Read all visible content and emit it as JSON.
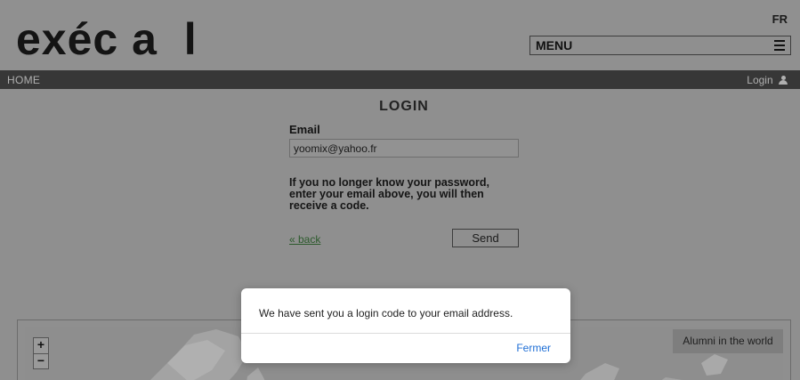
{
  "header": {
    "logo": "exéc a  l",
    "language": "FR",
    "menu_label": "MENU"
  },
  "nav": {
    "home": "HOME",
    "login": "Login"
  },
  "login_form": {
    "title": "LOGIN",
    "email_label": "Email",
    "email_value": "yoomix@yahoo.fr",
    "info_text": "If you no longer know your password, enter your email above, you will then receive a code.",
    "back_link": "« back",
    "send_button": "Send"
  },
  "map": {
    "zoom_in": "+",
    "zoom_out": "−",
    "label": "Alumni in the world"
  },
  "dialog": {
    "message": "We have sent you a login code to your email address.",
    "close_button": "Fermer"
  },
  "colors": {
    "overlay_bg": "#8f8f8f",
    "navbar_bg": "#373737",
    "dialog_bg": "#ffffff",
    "dialog_button": "#1f6fd6",
    "link": "#2c5a2c"
  }
}
